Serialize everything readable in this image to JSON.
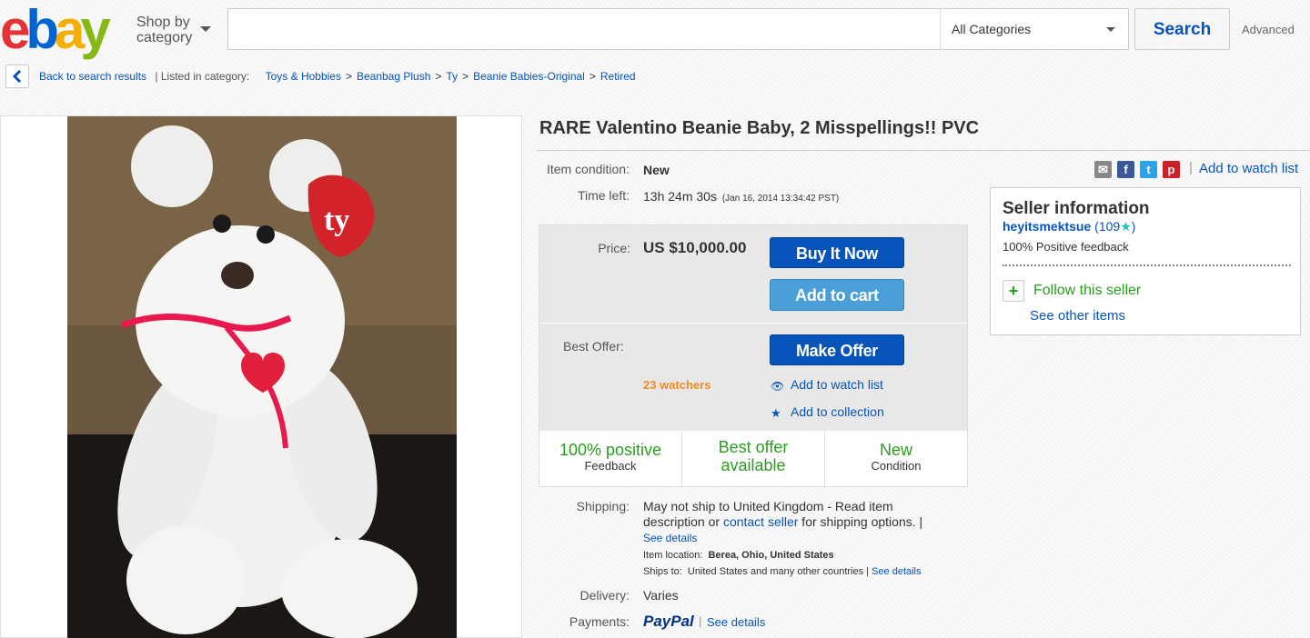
{
  "header": {
    "logo": [
      "e",
      "b",
      "a",
      "y"
    ],
    "logo_colors": [
      "#e53238",
      "#0064d2",
      "#f5af02",
      "#86b817"
    ],
    "shop_by_line1": "Shop by",
    "shop_by_line2": "category",
    "search_placeholder": "",
    "category_selected": "All Categories",
    "search_label": "Search",
    "advanced_label": "Advanced"
  },
  "breadcrumb": {
    "back_label": "Back to search results",
    "listed_label": "| Listed in category:",
    "categories": [
      "Toys & Hobbies",
      "Beanbag Plush",
      "Ty",
      "Beanie Babies-Original",
      "Retired"
    ],
    "separator": ">"
  },
  "listing": {
    "title": "RARE Valentino Beanie Baby, 2 Misspellings!! PVC",
    "condition_label": "Item condition:",
    "condition_value": "New",
    "time_left_label": "Time left:",
    "time_left_value": "13h 24m 30s",
    "time_left_date": "(Jan 16, 2014  13:34:42 PST)",
    "add_to_watch_list": "Add to watch list",
    "share_icons": [
      "email-icon",
      "facebook-icon",
      "twitter-icon",
      "pinterest-icon"
    ]
  },
  "buybox": {
    "price_label": "Price:",
    "price_value": "US $10,000.00",
    "buy_now_label": "Buy It Now",
    "add_to_cart_label": "Add to cart",
    "best_offer_label": "Best Offer:",
    "make_offer_label": "Make Offer",
    "watchers": "23 watchers",
    "watch_list_link": "Add to watch list",
    "collection_link": "Add to collection",
    "stats": [
      {
        "big": "100% positive",
        "small": "Feedback"
      },
      {
        "big": "Best offer available",
        "small": ""
      },
      {
        "big": "New",
        "small": "Condition"
      }
    ]
  },
  "shipping": {
    "label": "Shipping:",
    "text_part1": "May not ship to United Kingdom - Read item description or ",
    "contact_link": "contact seller",
    "text_part2": " for shipping options. |",
    "see_details": "See details",
    "location_label": "Item location:",
    "location_value": "Berea, Ohio, United States",
    "ships_to_label": "Ships to:",
    "ships_to_value": "United States and many other countries |",
    "ships_see_details": "See details"
  },
  "delivery": {
    "label": "Delivery:",
    "value": "Varies"
  },
  "payments": {
    "label": "Payments:",
    "paypal": "PayPal",
    "see_details": "See details"
  },
  "seller": {
    "heading": "Seller information",
    "name": "heyitsmektsue",
    "score": "(109",
    "score_end": ")",
    "positive": "100% Positive feedback",
    "follow": "Follow this seller",
    "see_other": "See other items"
  }
}
